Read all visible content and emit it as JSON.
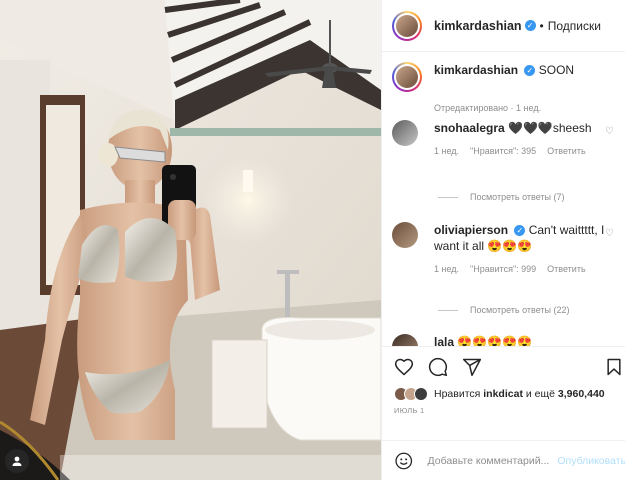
{
  "post": {
    "username": "kimkardashian",
    "follow_label": "Подписки",
    "options_icon": "more-icon"
  },
  "caption": {
    "username": "kimkardashian",
    "text": "SOON",
    "meta": "Отредактировано · 1 нед."
  },
  "comments": [
    {
      "username": "snohaalegra",
      "text": "🖤🖤🖤sheesh",
      "time": "1 нед.",
      "likes": "\"Нравится\": 395",
      "reply_label": "Ответить",
      "replies": "Посмотреть ответы (7)"
    },
    {
      "username": "oliviapierson",
      "text": "Can't waittttt, I want it all 😍😍😍",
      "time": "1 нед.",
      "likes": "\"Нравится\": 999",
      "reply_label": "Ответить",
      "replies": "Посмотреть ответы (22)"
    },
    {
      "username": "lala",
      "text": "😍😍😍😍😍"
    }
  ],
  "likes": {
    "prefix": "Нравится",
    "user": "inkdicat",
    "suffix": "и ещё",
    "count": "3,960,440"
  },
  "date": "ИЮЛЬ 1",
  "add_comment": {
    "placeholder": "Добавьте комментарий...",
    "post_label": "Опубликовать"
  },
  "colors": {
    "accent": "#3897f0",
    "post_disabled": "#b2dffc",
    "muted": "#8e8e8e"
  }
}
